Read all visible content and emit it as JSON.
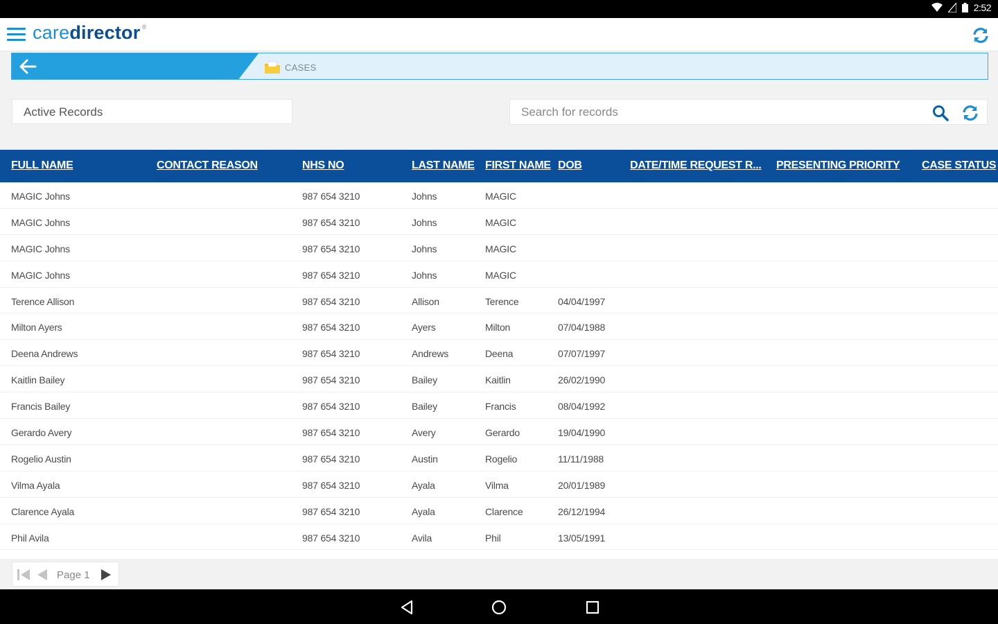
{
  "status_bar": {
    "time": "2:52"
  },
  "header": {
    "logo_part1": "care",
    "logo_part2": "director",
    "logo_mark": "®"
  },
  "breadcrumb": {
    "current": "CASES"
  },
  "view_selector": {
    "value": "Active Records"
  },
  "search": {
    "placeholder": "Search for records",
    "value": ""
  },
  "table": {
    "columns": [
      "FULL NAME",
      "CONTACT REASON",
      "NHS NO",
      "LAST NAME",
      "FIRST NAME",
      "DOB",
      "DATE/TIME REQUEST R...",
      "PRESENTING PRIORITY",
      "CASE STATUS"
    ],
    "rows": [
      [
        "MAGIC Johns",
        "",
        "987 654 3210",
        "Johns",
        "MAGIC",
        "",
        "",
        "",
        ""
      ],
      [
        "MAGIC Johns",
        "",
        "987 654 3210",
        "Johns",
        "MAGIC",
        "",
        "",
        "",
        ""
      ],
      [
        "MAGIC Johns",
        "",
        "987 654 3210",
        "Johns",
        "MAGIC",
        "",
        "",
        "",
        ""
      ],
      [
        "MAGIC Johns",
        "",
        "987 654 3210",
        "Johns",
        "MAGIC",
        "",
        "",
        "",
        ""
      ],
      [
        "Terence Allison",
        "",
        "987 654 3210",
        "Allison",
        "Terence",
        "04/04/1997",
        "",
        "",
        ""
      ],
      [
        "Milton Ayers",
        "",
        "987 654 3210",
        "Ayers",
        "Milton",
        "07/04/1988",
        "",
        "",
        ""
      ],
      [
        "Deena Andrews",
        "",
        "987 654 3210",
        "Andrews",
        "Deena",
        "07/07/1997",
        "",
        "",
        ""
      ],
      [
        "Kaitlin Bailey",
        "",
        "987 654 3210",
        "Bailey",
        "Kaitlin",
        "26/02/1990",
        "",
        "",
        ""
      ],
      [
        "Francis Bailey",
        "",
        "987 654 3210",
        "Bailey",
        "Francis",
        "08/04/1992",
        "",
        "",
        ""
      ],
      [
        "Gerardo Avery",
        "",
        "987 654 3210",
        "Avery",
        "Gerardo",
        "19/04/1990",
        "",
        "",
        ""
      ],
      [
        "Rogelio Austin",
        "",
        "987 654 3210",
        "Austin",
        "Rogelio",
        "11/11/1988",
        "",
        "",
        ""
      ],
      [
        "Vilma Ayala",
        "",
        "987 654 3210",
        "Ayala",
        "Vilma",
        "20/01/1989",
        "",
        "",
        ""
      ],
      [
        "Clarence Ayala",
        "",
        "987 654 3210",
        "Ayala",
        "Clarence",
        "26/12/1994",
        "",
        "",
        ""
      ],
      [
        "Phil Avila",
        "",
        "987 654 3210",
        "Avila",
        "Phil",
        "13/05/1991",
        "",
        "",
        ""
      ]
    ]
  },
  "pager": {
    "label": "Page 1"
  },
  "colors": {
    "brand_blue": "#1f8fd0",
    "header_navy": "#0b4f9a",
    "crumb_blue": "#23a0dd"
  },
  "icons": [
    "hamburger-menu-icon",
    "sync-icon",
    "back-arrow-icon",
    "folder-icon",
    "search-icon",
    "refresh-icon",
    "first-page-icon",
    "prev-page-icon",
    "next-page-icon",
    "nav-back-icon",
    "nav-home-icon",
    "nav-recents-icon"
  ]
}
